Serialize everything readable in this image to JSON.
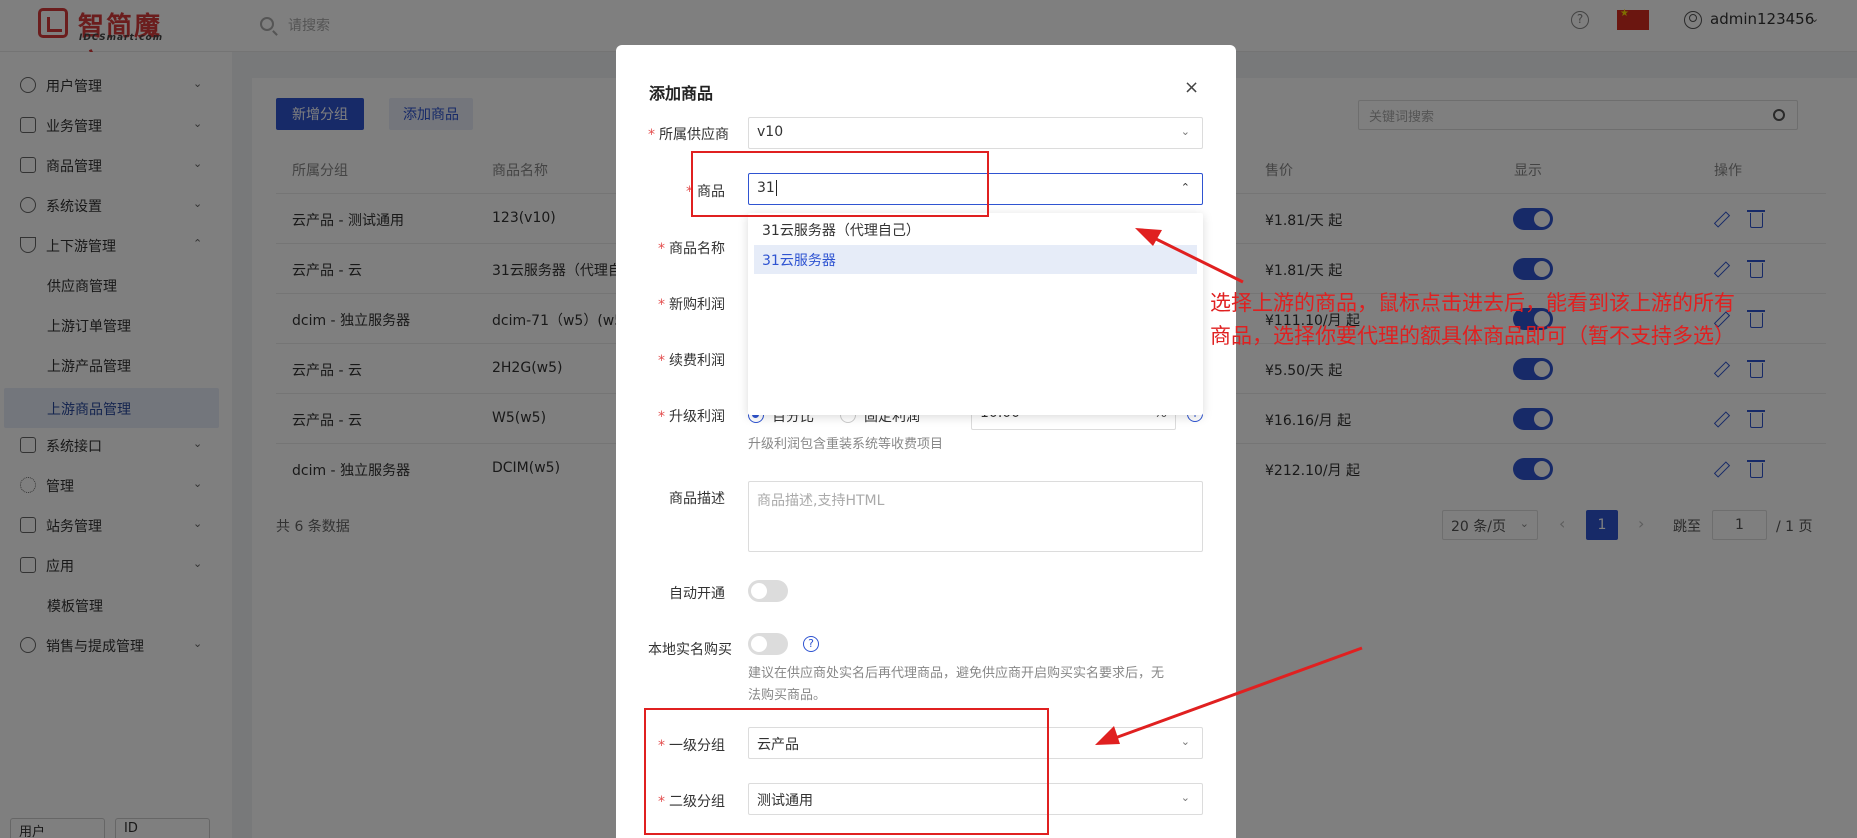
{
  "header": {
    "logo_text": "智简魔方",
    "logo_sub": "IDCSmart.com",
    "search_placeholder": "请搜索",
    "help_icon": "?",
    "username": "admin123456"
  },
  "sidebar": {
    "items": [
      {
        "label": "用户管理",
        "icon": "user-icon"
      },
      {
        "label": "业务管理",
        "icon": "list-icon"
      },
      {
        "label": "商品管理",
        "icon": "cart-icon"
      },
      {
        "label": "系统设置",
        "icon": "gear-icon"
      },
      {
        "label": "上下游管理",
        "icon": "filter-icon"
      },
      {
        "label": "供应商管理"
      },
      {
        "label": "上游订单管理"
      },
      {
        "label": "上游产品管理"
      },
      {
        "label": "上游商品管理"
      },
      {
        "label": "系统接口",
        "icon": "folder-icon"
      },
      {
        "label": "管理",
        "icon": "sun-icon"
      },
      {
        "label": "站务管理",
        "icon": "folder-icon"
      },
      {
        "label": "应用",
        "icon": "box-icon"
      },
      {
        "label": "模板管理"
      },
      {
        "label": "销售与提成管理",
        "icon": "wrench-icon"
      }
    ],
    "bottom_select_1": "用户",
    "bottom_select_2": "ID"
  },
  "toolbar": {
    "add_group": "新增分组",
    "add_product": "添加商品",
    "keyword_placeholder": "关键词搜索"
  },
  "table": {
    "headers": [
      "所属分组",
      "商品名称",
      "售价",
      "显示",
      "操作"
    ],
    "rows": [
      {
        "group": "云产品 - 测试通用",
        "name": "123(v10)",
        "price": "¥1.81/天 起"
      },
      {
        "group": "云产品 - 云",
        "name": "31云服务器（代理自",
        "price": "¥1.81/天 起"
      },
      {
        "group": "dcim - 独立服务器",
        "name": "dcim-71（w5）(w5",
        "price": "¥111.10/月 起"
      },
      {
        "group": "云产品 - 云",
        "name": "2H2G(w5)",
        "price": "¥5.50/天 起"
      },
      {
        "group": "云产品 - 云",
        "name": "W5(w5)",
        "price": "¥16.16/月 起"
      },
      {
        "group": "dcim - 独立服务器",
        "name": "DCIM(w5)",
        "price": "¥212.10/月 起"
      }
    ],
    "total": "共 6 条数据"
  },
  "pagination": {
    "page_size": "20 条/页",
    "prev": "‹",
    "current": "1",
    "next": "›",
    "jump_label": "跳至",
    "jump_value": "1",
    "total_pages": "/ 1 页"
  },
  "modal": {
    "title": "添加商品",
    "close": "×",
    "supplier_label": "所属供应商",
    "supplier_value": "v10",
    "product_label": "商品",
    "product_value": "31",
    "dropdown_options": [
      "31云服务器（代理自己）",
      "31云服务器"
    ],
    "name_label": "商品名称",
    "new_profit_label": "新购利润",
    "renew_profit_label": "续费利润",
    "upgrade_profit_label": "升级利润",
    "upgrade_opt1": "百分比",
    "upgrade_opt2": "固定利润",
    "upgrade_value": "10.00",
    "upgrade_unit": "%",
    "upgrade_hint": "升级利润包含重装系统等收费项目",
    "desc_label": "商品描述",
    "desc_placeholder": "商品描述,支持HTML",
    "auto_open_label": "自动开通",
    "realname_label": "本地实名购买",
    "realname_hint_1": "建议在供应商处实名后再代理商品，避免供应商开启购买实名要求后，无",
    "realname_hint_2": "法购买商品。",
    "group1_label": "一级分组",
    "group1_value": "云产品",
    "group2_label": "二级分组",
    "group2_value": "测试通用"
  },
  "annotation": {
    "line1": "选择上游的商品，鼠标点击进去后，能看到该上游的所有",
    "line2": "商品，选择你要代理的额具体商品即可（暂不支持多选）",
    "color": "#e02020"
  }
}
